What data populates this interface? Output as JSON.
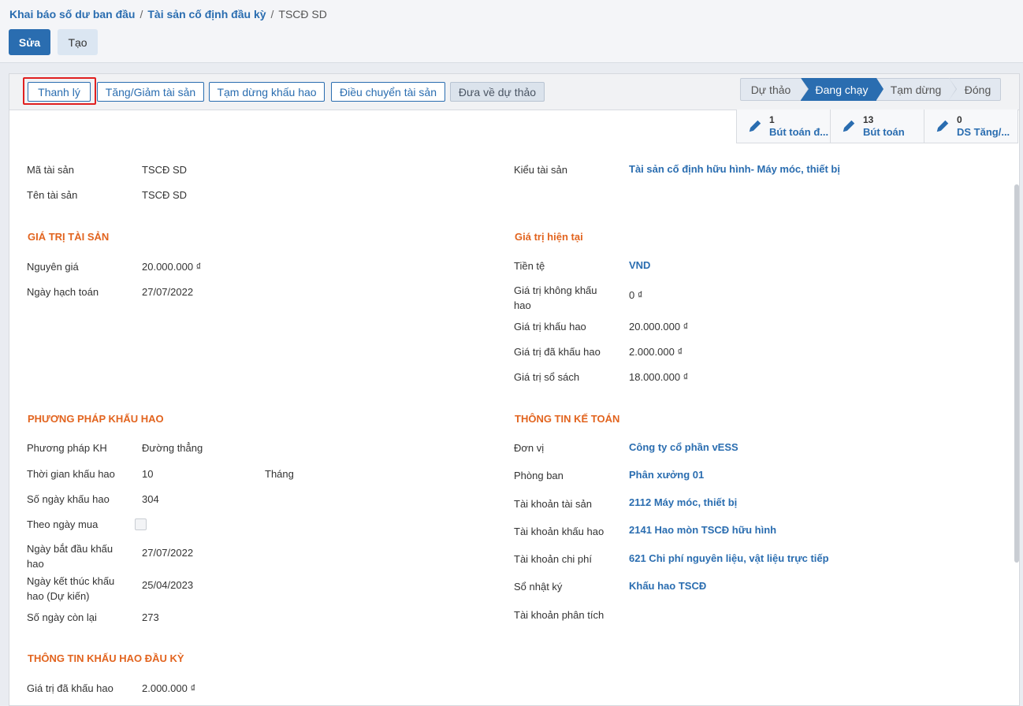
{
  "breadcrumb": {
    "items": [
      "Khai báo số dư ban đầu",
      "Tài sản cố định đầu kỳ"
    ],
    "separator": "/",
    "current": "TSCĐ SD"
  },
  "toolbar": {
    "edit_label": "Sửa",
    "create_label": "Tạo"
  },
  "actions": {
    "liquidate": "Thanh lý",
    "increase_decrease": "Tăng/Giảm tài sản",
    "pause_depreciation": "Tạm dừng khấu hao",
    "transfer": "Điều chuyển tài sản",
    "set_draft": "Đưa về dự thảo"
  },
  "stages": [
    {
      "label": "Dự thảo",
      "active": false
    },
    {
      "label": "Đang chạy",
      "active": true
    },
    {
      "label": "Tạm dừng",
      "active": false
    },
    {
      "label": "Đóng",
      "active": false
    }
  ],
  "smart_buttons": [
    {
      "count": "1",
      "label": "Bút toán đ...",
      "icon": "pencil-icon"
    },
    {
      "count": "13",
      "label": "Bút toán",
      "icon": "pencil-icon"
    },
    {
      "count": "0",
      "label": "DS Tăng/...",
      "icon": "pencil-icon"
    }
  ],
  "fields": {
    "asset_code": {
      "label": "Mã tài sản",
      "value": "TSCĐ SD"
    },
    "asset_name": {
      "label": "Tên tài sản",
      "value": "TSCĐ SD"
    },
    "asset_type": {
      "label": "Kiểu tài sản",
      "value": "Tài sản cố định hữu hình- Máy móc, thiết bị"
    }
  },
  "asset_value": {
    "title": "GIÁ TRỊ TÀI SẢN",
    "original_price": {
      "label": "Nguyên giá",
      "value": "20.000.000 ₫"
    },
    "accounting_date": {
      "label": "Ngày hạch toán",
      "value": "27/07/2022"
    }
  },
  "current_value": {
    "title": "Giá trị hiện tại",
    "currency": {
      "label": "Tiền tệ",
      "value": "VND"
    },
    "non_depreciable": {
      "label": "Giá trị không khấu hao",
      "value": "0 ₫"
    },
    "depreciable": {
      "label": "Giá trị khấu hao",
      "value": "20.000.000 ₫"
    },
    "depreciated": {
      "label": "Giá trị đã khấu hao",
      "value": "2.000.000 ₫"
    },
    "book_value": {
      "label": "Giá trị sổ sách",
      "value": "18.000.000 ₫"
    }
  },
  "depreciation_method": {
    "title": "PHƯƠNG PHÁP KHẤU HAO",
    "method": {
      "label": "Phương pháp KH",
      "value": "Đường thẳng"
    },
    "duration": {
      "label": "Thời gian khấu hao",
      "value": "10",
      "unit": "Tháng"
    },
    "days": {
      "label": "Số ngày khấu hao",
      "value": "304"
    },
    "by_purchase_date": {
      "label": "Theo ngày mua",
      "checked": false
    },
    "start_date": {
      "label": "Ngày bắt đầu khấu hao",
      "value": "27/07/2022"
    },
    "end_date": {
      "label": "Ngày kết thúc khấu hao (Dự kiến)",
      "value": "25/04/2023"
    },
    "remaining_days": {
      "label": "Số ngày còn lại",
      "value": "273"
    }
  },
  "accounting_info": {
    "title": "THÔNG TIN KẾ TOÁN",
    "company": {
      "label": "Đơn vị",
      "value": "Công ty cổ phần vESS"
    },
    "department": {
      "label": "Phòng ban",
      "value": "Phân xưởng 01"
    },
    "asset_account": {
      "label": "Tài khoản tài sản",
      "value": "2112 Máy móc, thiết bị"
    },
    "depreciation_account": {
      "label": "Tài khoản khấu hao",
      "value": "2141 Hao mòn TSCĐ hữu hình"
    },
    "expense_account": {
      "label": "Tài khoản chi phí",
      "value": "621 Chi phí nguyên liệu, vật liệu trực tiếp"
    },
    "journal": {
      "label": "Sổ nhật ký",
      "value": "Khấu hao TSCĐ"
    },
    "analytic_account": {
      "label": "Tài khoản phân tích",
      "value": ""
    }
  },
  "opening_depreciation": {
    "title": "THÔNG TIN KHẤU HAO ĐẦU KỲ",
    "depreciated": {
      "label": "Giá trị đã khấu hao",
      "value": "2.000.000 ₫"
    }
  },
  "colors": {
    "primary": "#2a6db0",
    "section": "#e2641f",
    "highlight": "#e02020"
  }
}
